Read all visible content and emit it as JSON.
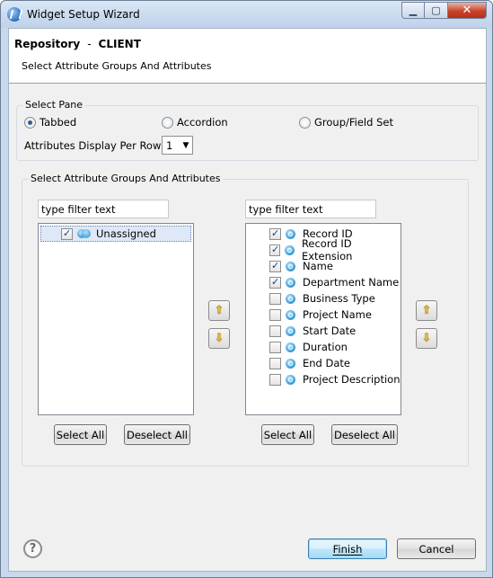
{
  "window": {
    "title": "Widget Setup Wizard"
  },
  "header": {
    "repository_label": "Repository",
    "separator": "-",
    "client_label": "CLIENT",
    "subtitle": "Select Attribute Groups And Attributes"
  },
  "select_pane": {
    "legend": "Select Pane",
    "options": [
      {
        "label": "Tabbed",
        "selected": true
      },
      {
        "label": "Accordion",
        "selected": false
      },
      {
        "label": "Group/Field Set",
        "selected": false
      }
    ],
    "per_row_label": "Attributes Display Per Row :",
    "per_row_value": "1"
  },
  "attributes_section": {
    "legend": "Select Attribute Groups And Attributes",
    "left": {
      "filter_text": "type filter text",
      "items": [
        {
          "label": "Unassigned",
          "checked": true,
          "icon": "attribute-group-icon"
        }
      ],
      "select_all": "Select All",
      "deselect_all": "Deselect All"
    },
    "right": {
      "filter_text": "type filter text",
      "items": [
        {
          "label": "Record ID",
          "checked": true
        },
        {
          "label": "Record ID Extension",
          "checked": true
        },
        {
          "label": "Name",
          "checked": true
        },
        {
          "label": "Department Name",
          "checked": true
        },
        {
          "label": "Business Type",
          "checked": false
        },
        {
          "label": "Project Name",
          "checked": false
        },
        {
          "label": "Start Date",
          "checked": false
        },
        {
          "label": "Duration",
          "checked": false
        },
        {
          "label": "End Date",
          "checked": false
        },
        {
          "label": "Project Description",
          "checked": false
        }
      ],
      "select_all": "Select All",
      "deselect_all": "Deselect All"
    },
    "move_up_icon": "arrow-up-icon",
    "move_down_icon": "arrow-down-icon"
  },
  "footer": {
    "help_glyph": "?",
    "finish_label": "Finish",
    "cancel_label": "Cancel"
  },
  "titlebar_glyphs": {
    "minimize": "▁",
    "maximize": "▢",
    "close": "✕"
  },
  "colors": {
    "window_frame": "#c9d9ec",
    "close_button": "#c8432b",
    "selection_bg": "#dfe8f7",
    "default_button_border": "#3c7fb1"
  }
}
